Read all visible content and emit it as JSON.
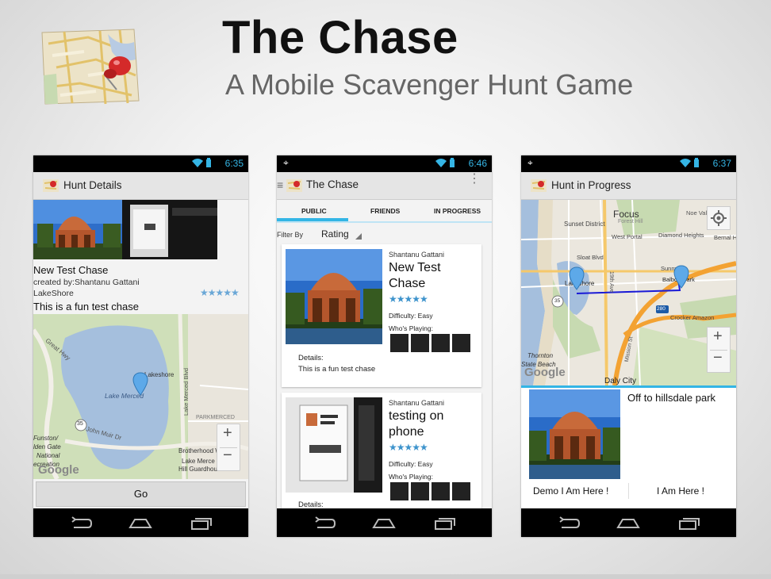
{
  "slide": {
    "title": "The Chase",
    "subtitle": "A Mobile Scavenger Hunt Game"
  },
  "phone1": {
    "time": "6:35",
    "title": "Hunt Details",
    "hunt_name": "New Test Chase",
    "created_by": "created by:Shantanu Gattani",
    "location": "LakeShore",
    "rating_stars": "★★★★★",
    "description": "This is a fun test chase",
    "map_labels": {
      "great_hwy": "Great Hwy",
      "lake_merced": "Lake Merced",
      "lakeshore": "Lakeshore",
      "lake_merced_blvd": "Lake Merced Blvd",
      "parkmerced": "PARKMERCED",
      "route": "35",
      "john_muir": "John Muir Dr",
      "funston": "Funston/",
      "golden_gate": "lden Gate",
      "national": "National",
      "recreation": "ecreation",
      "brotherhood": "Brotherhood Way",
      "lake_merce": "Lake Merce",
      "hill_guardhouse": "Hill Guardhouse",
      "google": "Google"
    },
    "zoom_in": "+",
    "zoom_out": "−",
    "go_button": "Go"
  },
  "phone2": {
    "time": "6:46",
    "title": "The Chase",
    "tabs": [
      "PUBLIC",
      "FRIENDS",
      "IN PROGRESS"
    ],
    "filter_label": "Filter By",
    "filter_value": "Rating",
    "cards": [
      {
        "author": "Shantanu Gattani",
        "name_line1": "New Test",
        "name_line2": "Chase",
        "stars": "★★★★★",
        "difficulty": "Difficulty: Easy",
        "whos_playing": "Who's Playing:",
        "details_label": "Details:",
        "details": "This is a fun test chase"
      },
      {
        "author": "Shantanu Gattani",
        "name_line1": "testing on",
        "name_line2": "phone",
        "stars": "★★★★★",
        "difficulty": "Difficulty: Easy",
        "whos_playing": "Who's Playing:",
        "details_label": "Details:"
      }
    ]
  },
  "phone3": {
    "time": "6:37",
    "title": "Hunt in Progress",
    "map_labels": {
      "focus": "Focus",
      "forest_hill": "Forest Hill",
      "noe": "Noe Val",
      "sunset": "Sunset District",
      "west_portal": "West Portal",
      "diamond": "Diamond Heights",
      "bernal": "Bernal H",
      "sloat": "Sloat Blvd",
      "lakeshore": "Lakeshore",
      "sunny": "Sunny",
      "balboa": "Balboa Park",
      "route35": "35",
      "route280": "280",
      "crocker": "Crocker Amazon",
      "thornton": "Thornton",
      "state_beach": "State Beach",
      "daly": "Daly City",
      "google": "Google",
      "nineteenth": "19th Ave",
      "mission": "Mission St"
    },
    "zoom_in": "+",
    "zoom_out": "−",
    "clue": "Off to hillsdale park",
    "demo_button": "Demo I Am Here !",
    "here_button": "I Am Here !"
  },
  "icons": [
    "map-pin-logo-icon",
    "wifi-icon",
    "battery-icon",
    "location-icon",
    "back-icon",
    "home-icon",
    "recent-apps-icon",
    "overflow-menu-icon",
    "my-location-icon",
    "map-marker-icon",
    "star-icon"
  ],
  "colors": {
    "holo_blue": "#35b5e5",
    "tab_indicator": "#33b5e5",
    "map_water": "#a5bfdd",
    "map_park": "#c7dab1"
  }
}
